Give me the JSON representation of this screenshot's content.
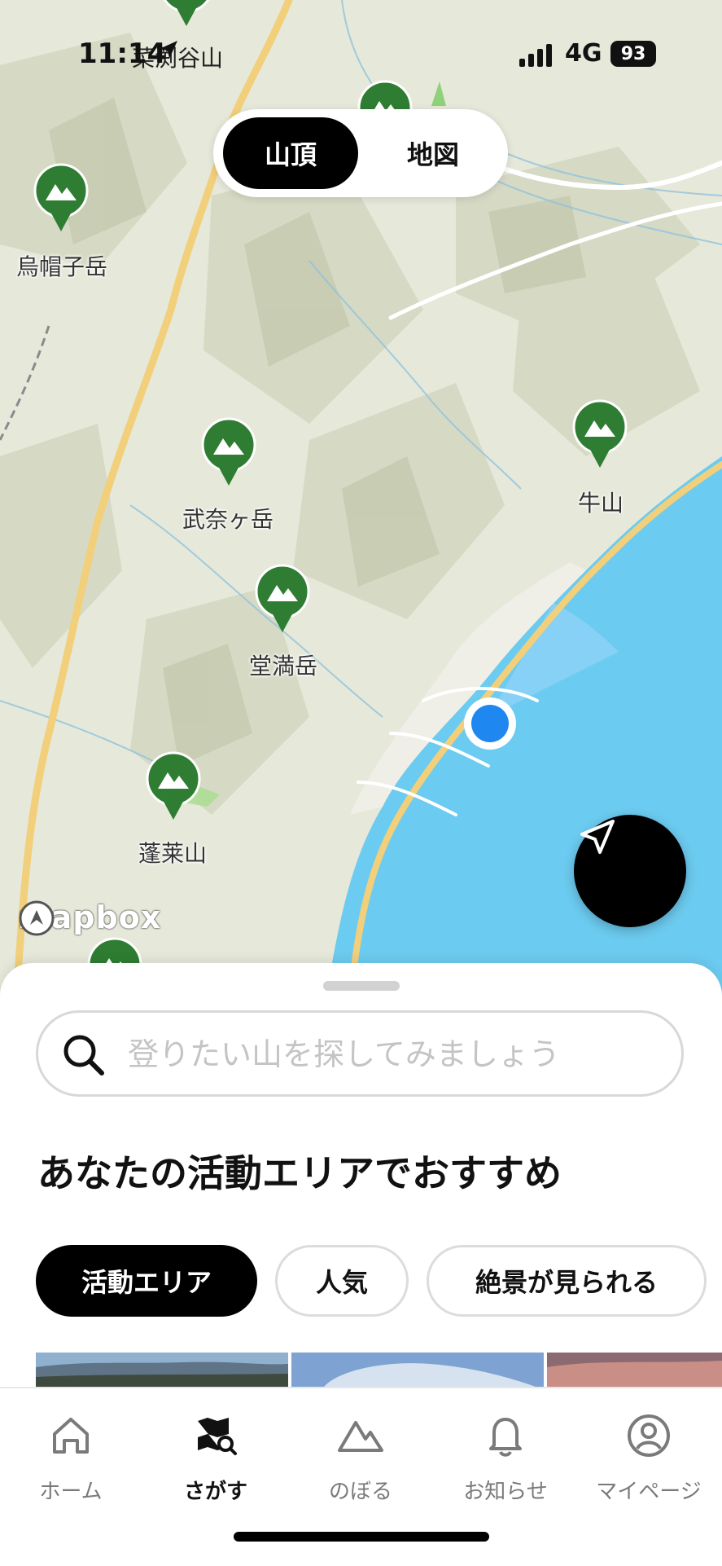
{
  "status_bar": {
    "time": "11:14",
    "carrier_overlay": "菜渕谷山",
    "network": "4G",
    "battery": "93"
  },
  "toggle": {
    "summit_label": "山頂",
    "map_label": "地図"
  },
  "peaks": [
    {
      "name": "烏帽子岳"
    },
    {
      "name": "武奈ヶ岳"
    },
    {
      "name": "堂満岳"
    },
    {
      "name": "蓬莱山"
    },
    {
      "name": "牛山"
    }
  ],
  "map": {
    "attribution": "mapbox",
    "water_color": "#6ccbf0",
    "land_color": "#e6e8da",
    "pin_color": "#2e7d32",
    "road_color": "#f2cf7a"
  },
  "sheet": {
    "search_placeholder": "登りたい山を探してみましょう",
    "section_title": "あなたの活動エリアでおすすめ",
    "chips": [
      "活動エリア",
      "人気",
      "絶景が見られる"
    ]
  },
  "tabs": [
    {
      "label": "ホーム",
      "icon": "home-icon"
    },
    {
      "label": "さがす",
      "icon": "map-search-icon"
    },
    {
      "label": "のぼる",
      "icon": "mountain-icon"
    },
    {
      "label": "お知らせ",
      "icon": "bell-icon"
    },
    {
      "label": "マイページ",
      "icon": "user-icon"
    }
  ]
}
